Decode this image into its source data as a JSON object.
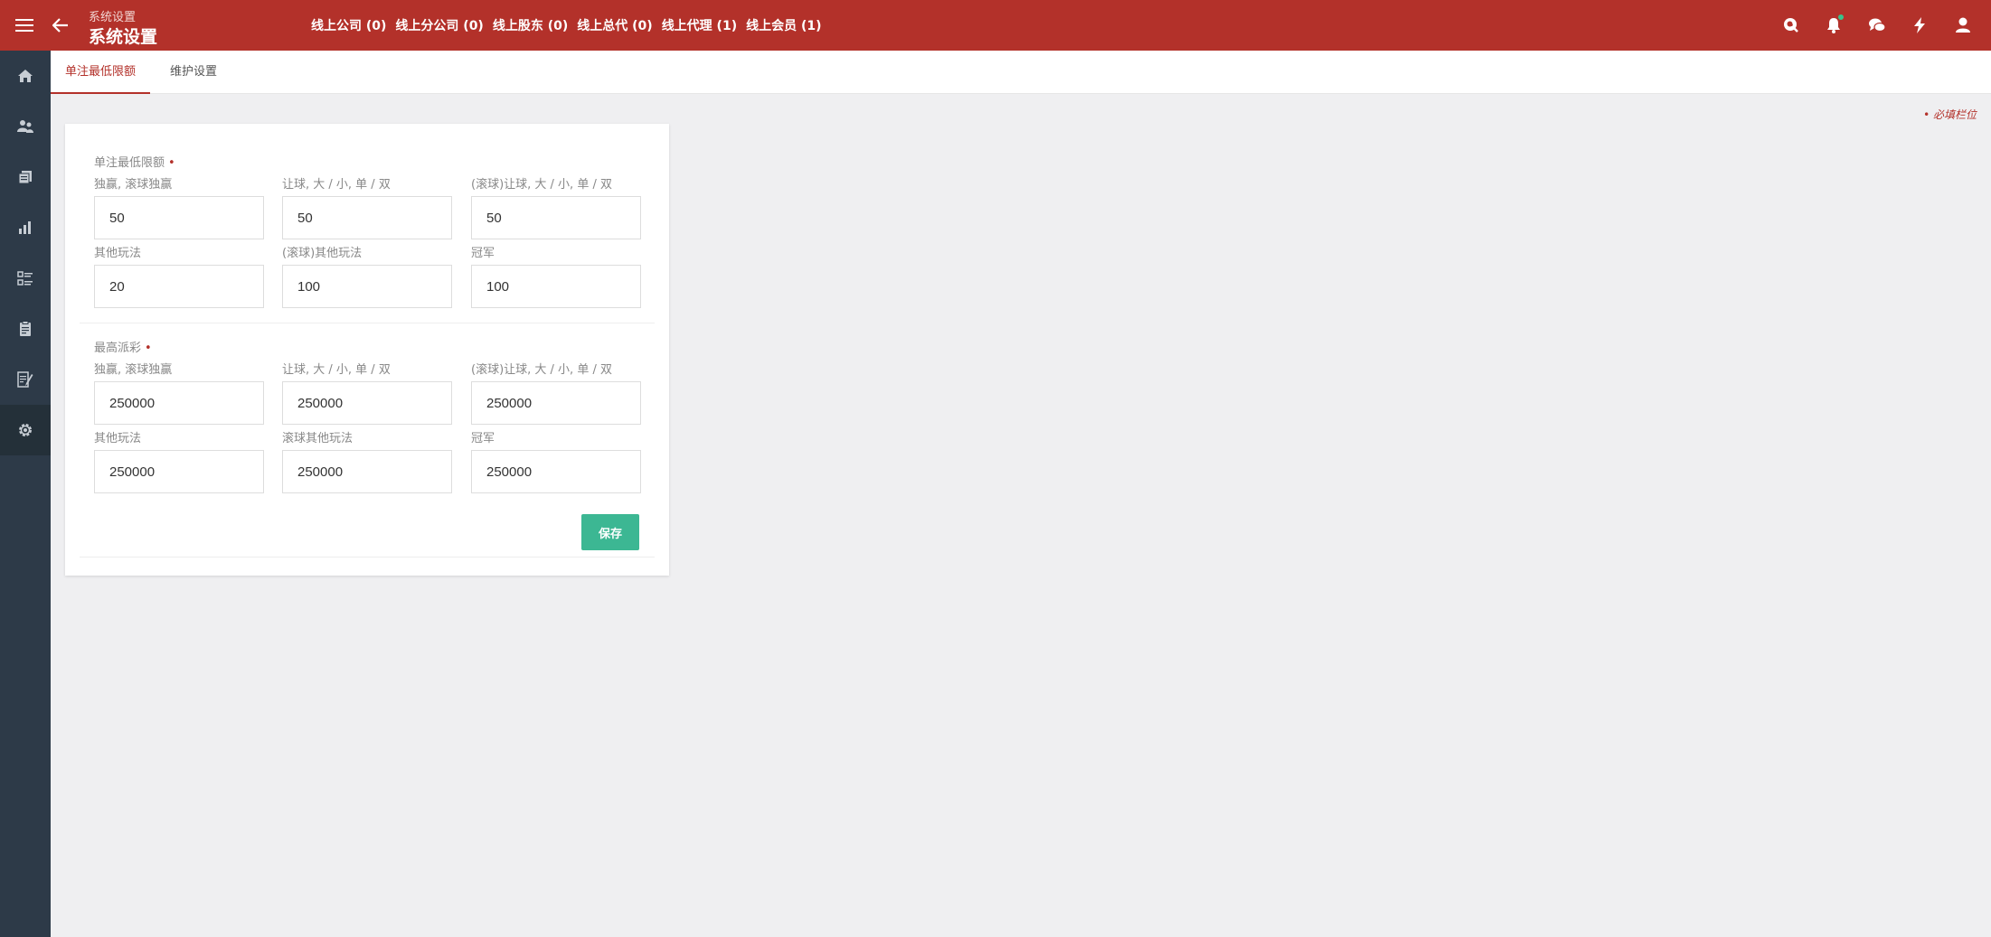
{
  "header": {
    "breadcrumb": "系统设置",
    "title": "系统设置",
    "stats": [
      "线上公司 (0)",
      "线上分公司 (0)",
      "线上股东 (0)",
      "线上总代 (0)",
      "线上代理 (1)",
      "线上会员 (1)"
    ],
    "background_color": "#b3312a"
  },
  "sidebar": {
    "items": [
      "home-icon",
      "users-icon",
      "documents-icon",
      "chart-icon",
      "list-icon",
      "clipboard-icon",
      "report-icon",
      "settings-icon"
    ],
    "active": "settings-icon"
  },
  "tabs": [
    {
      "label": "单注最低限额",
      "active": true
    },
    {
      "label": "维护设置",
      "active": false
    }
  ],
  "required_note": "• 必填栏位",
  "form": {
    "min_bet": {
      "title": "单注最低限额",
      "required_mark": "•",
      "fields": [
        {
          "label": "独赢, 滚球独赢",
          "value": "50"
        },
        {
          "label": "让球, 大 / 小, 单 / 双",
          "value": "50"
        },
        {
          "label": "(滚球)让球, 大 / 小, 单 / 双",
          "value": "50"
        },
        {
          "label": "其他玩法",
          "value": "20"
        },
        {
          "label": "(滚球)其他玩法",
          "value": "100"
        },
        {
          "label": "冠军",
          "value": "100"
        }
      ]
    },
    "max_payout": {
      "title": "最高派彩",
      "required_mark": "•",
      "fields": [
        {
          "label": "独赢, 滚球独赢",
          "value": "250000"
        },
        {
          "label": "让球, 大 / 小, 单 / 双",
          "value": "250000"
        },
        {
          "label": "(滚球)让球, 大 / 小, 单 / 双",
          "value": "250000"
        },
        {
          "label": "其他玩法",
          "value": "250000"
        },
        {
          "label": "滚球其他玩法",
          "value": "250000"
        },
        {
          "label": "冠军",
          "value": "250000"
        }
      ]
    },
    "save_label": "保存",
    "save_color": "#3cb793"
  }
}
